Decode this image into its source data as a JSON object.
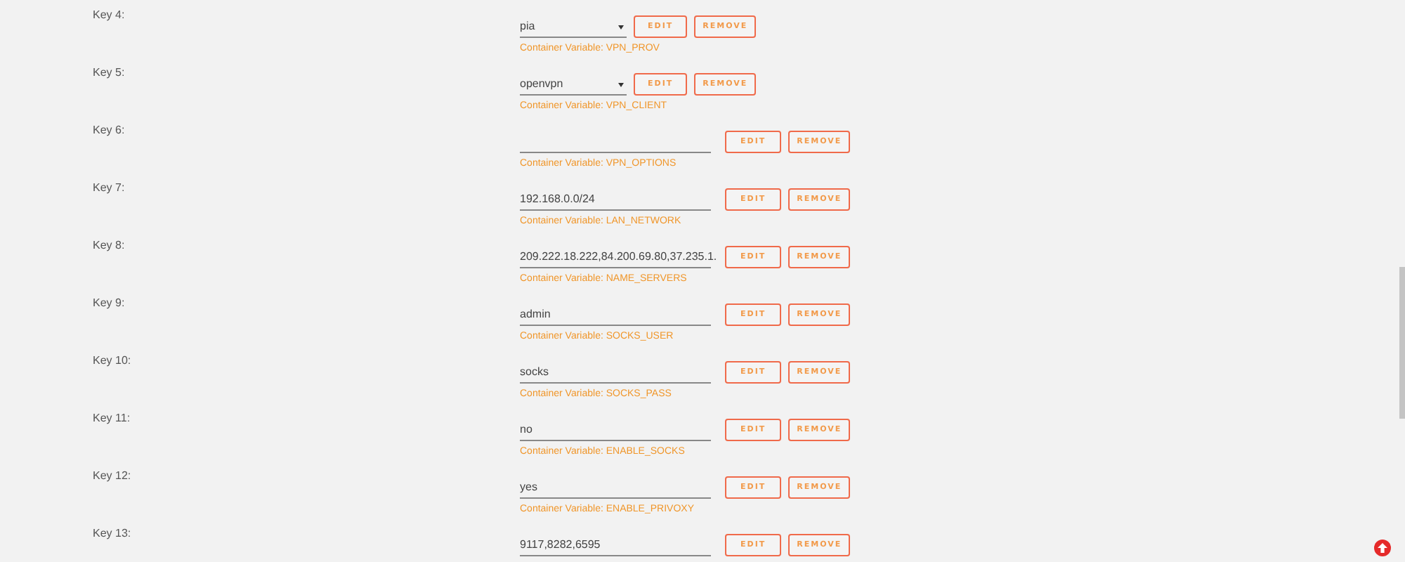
{
  "rows": [
    {
      "key": "Key 4:",
      "kind": "select",
      "value": "pia",
      "edit": "EDIT",
      "remove": "REMOVE",
      "caption": "Container Variable: VPN_PROV"
    },
    {
      "key": "Key 5:",
      "kind": "select",
      "value": "openvpn",
      "edit": "EDIT",
      "remove": "REMOVE",
      "caption": "Container Variable: VPN_CLIENT"
    },
    {
      "key": "Key 6:",
      "kind": "text",
      "edit": "EDIT",
      "remove": "REMOVE",
      "caption": "Container Variable: VPN_OPTIONS"
    },
    {
      "key": "Key 7:",
      "kind": "text",
      "value": "192.168.0.0/24",
      "edit": "EDIT",
      "remove": "REMOVE",
      "caption": "Container Variable: LAN_NETWORK"
    },
    {
      "key": "Key 8:",
      "kind": "text",
      "value": "209.222.18.222,84.200.69.80,37.235.1.",
      "edit": "EDIT",
      "remove": "REMOVE",
      "caption": "Container Variable: NAME_SERVERS"
    },
    {
      "key": "Key 9:",
      "kind": "text",
      "value": "admin",
      "edit": "EDIT",
      "remove": "REMOVE",
      "caption": "Container Variable: SOCKS_USER"
    },
    {
      "key": "Key 10:",
      "kind": "text",
      "value": "socks",
      "edit": "EDIT",
      "remove": "REMOVE",
      "caption": "Container Variable: SOCKS_PASS"
    },
    {
      "key": "Key 11:",
      "kind": "text",
      "value": "no",
      "edit": "EDIT",
      "remove": "REMOVE",
      "caption": "Container Variable: ENABLE_SOCKS"
    },
    {
      "key": "Key 12:",
      "kind": "text",
      "value": "yes",
      "edit": "EDIT",
      "remove": "REMOVE",
      "caption": "Container Variable: ENABLE_PRIVOXY"
    },
    {
      "key": "Key 13:",
      "kind": "text",
      "value": "9117,8282,6595",
      "edit": "EDIT",
      "remove": "REMOVE"
    }
  ]
}
